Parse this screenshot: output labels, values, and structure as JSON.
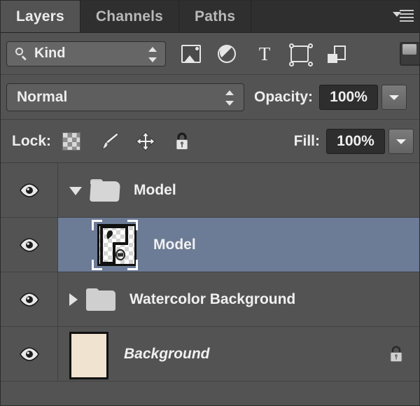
{
  "panel": {
    "title": "Layers",
    "tabs": [
      {
        "label": "Layers",
        "active": true
      },
      {
        "label": "Channels",
        "active": false
      },
      {
        "label": "Paths",
        "active": false
      }
    ],
    "menu_icon": "panel-menu-icon"
  },
  "filter": {
    "kind_label": "Kind",
    "search_icon": "magnifier-icon",
    "icons": [
      {
        "name": "filter-pixel-layers-icon"
      },
      {
        "name": "filter-adjustment-layers-icon"
      },
      {
        "name": "filter-type-layers-icon"
      },
      {
        "name": "filter-shape-layers-icon"
      },
      {
        "name": "filter-smart-object-layers-icon"
      }
    ],
    "toggle_name": "filter-enable-toggle"
  },
  "blend": {
    "mode": "Normal",
    "opacity_label": "Opacity:",
    "opacity_value": "100%"
  },
  "lock": {
    "label": "Lock:",
    "items": [
      {
        "name": "lock-transparent-pixels-icon"
      },
      {
        "name": "lock-image-pixels-icon"
      },
      {
        "name": "lock-position-icon"
      },
      {
        "name": "lock-all-icon"
      }
    ],
    "fill_label": "Fill:",
    "fill_value": "100%"
  },
  "layers": [
    {
      "name": "Model",
      "type": "group",
      "expanded": true,
      "visible": true,
      "selected": false,
      "italic": false,
      "locked": false
    },
    {
      "name": "Model",
      "type": "layer",
      "expanded": false,
      "visible": true,
      "selected": true,
      "italic": false,
      "locked": false,
      "thumbnail": "transparent-figure-thumbnail"
    },
    {
      "name": "Watercolor Background",
      "type": "group",
      "expanded": false,
      "visible": true,
      "selected": false,
      "italic": false,
      "locked": false
    },
    {
      "name": "Background",
      "type": "layer",
      "expanded": false,
      "visible": true,
      "selected": false,
      "italic": true,
      "locked": true,
      "thumbnail": "solid-cream-thumbnail"
    }
  ],
  "colors": {
    "panel_bg": "#535353",
    "tabbar_bg": "#2f2f2f",
    "selection": "#6c7b96",
    "text": "#f0f0f0",
    "background_thumb": "#f0e3cf",
    "field_dark": "#2e2e2e"
  }
}
